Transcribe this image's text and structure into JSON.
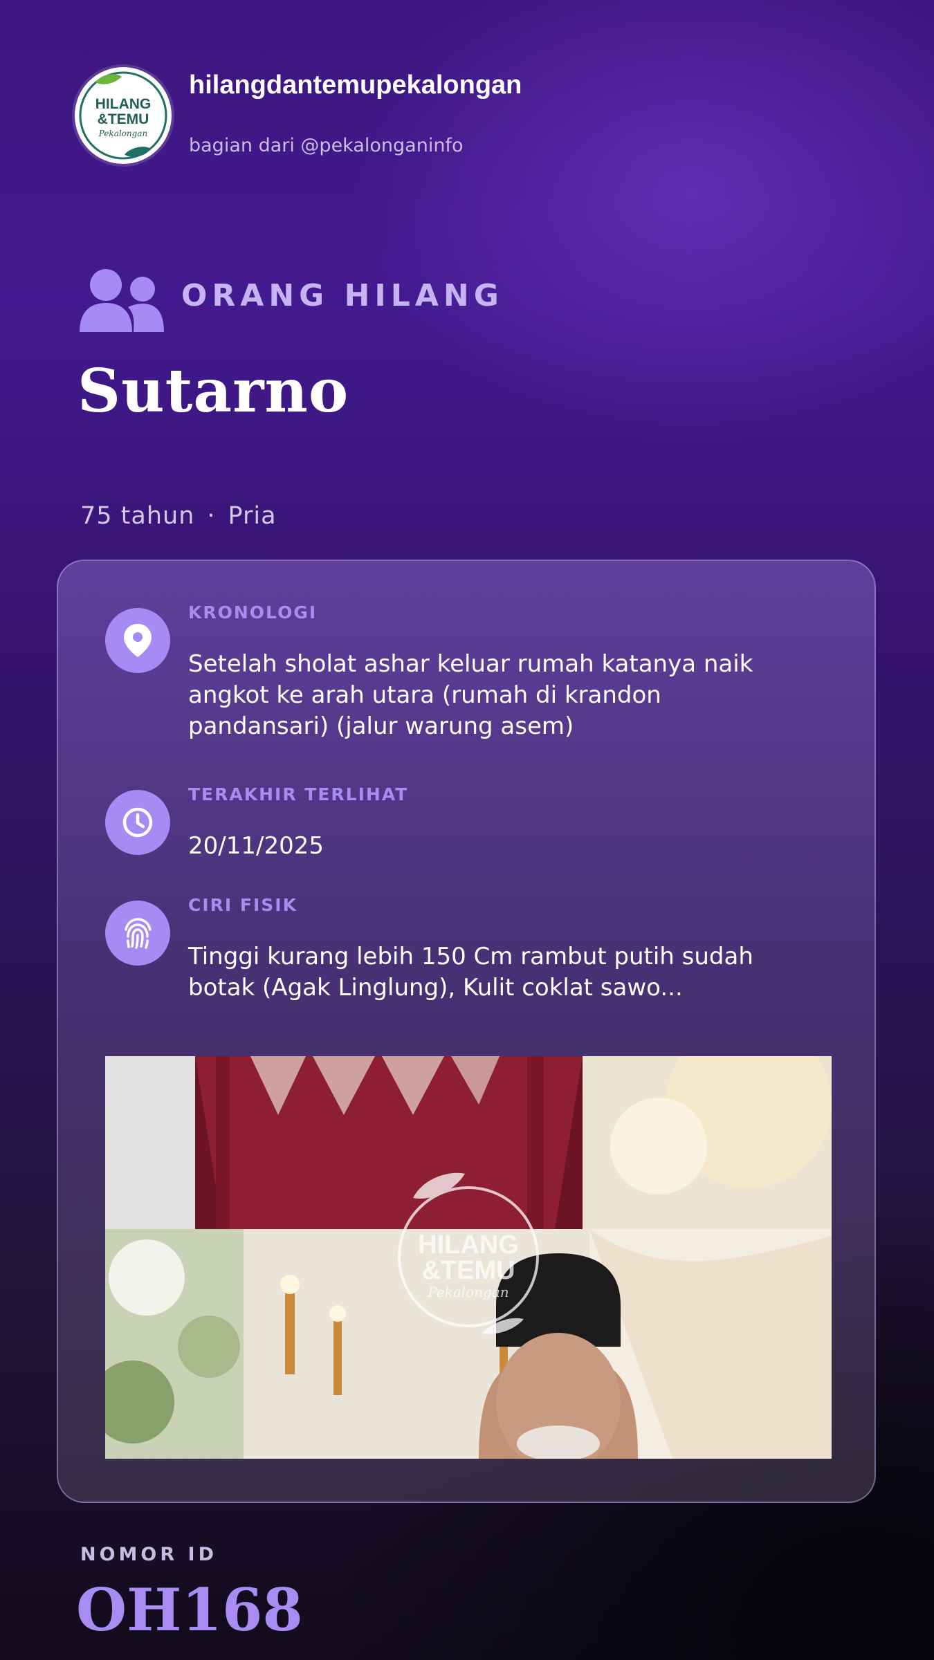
{
  "header": {
    "logo_text": {
      "line1": "HILANG",
      "line2": "&TEMU",
      "line3": "Pekalongan"
    },
    "handle": "hilangdantemupekalongan",
    "subhandle": "bagian dari @pekalonganinfo"
  },
  "category": {
    "icon": "users-icon",
    "label": "ORANG HILANG"
  },
  "person": {
    "name": "Sutarno",
    "age": "75 tahun",
    "separator": "·",
    "gender": "Pria"
  },
  "details": {
    "chronology": {
      "icon": "map-pin-icon",
      "label": "KRONOLOGI",
      "value": "Setelah sholat ashar keluar rumah katanya naik angkot ke arah utara (rumah di krandon pandansari) (jalur warung asem)"
    },
    "last_seen": {
      "icon": "clock-icon",
      "label": "TERAKHIR TERLIHAT",
      "value": "20/11/2025"
    },
    "physical": {
      "icon": "fingerprint-icon",
      "label": "CIRI FISIK",
      "value": "Tinggi kurang lebih 150 Cm rambut putih sudah botak (Agak Linglung), Kulit coklat sawo..."
    }
  },
  "photo": {
    "watermark": {
      "line1": "HILANG",
      "line2": "&TEMU",
      "line3": "Pekalongan"
    }
  },
  "footer": {
    "id_label": "NOMOR ID",
    "id_value": "OH168"
  },
  "colors": {
    "accent": "#a98cf2",
    "icon_bg": "#a78bf5",
    "background_top": "#3d167f",
    "background_bottom": "#110b1c"
  }
}
